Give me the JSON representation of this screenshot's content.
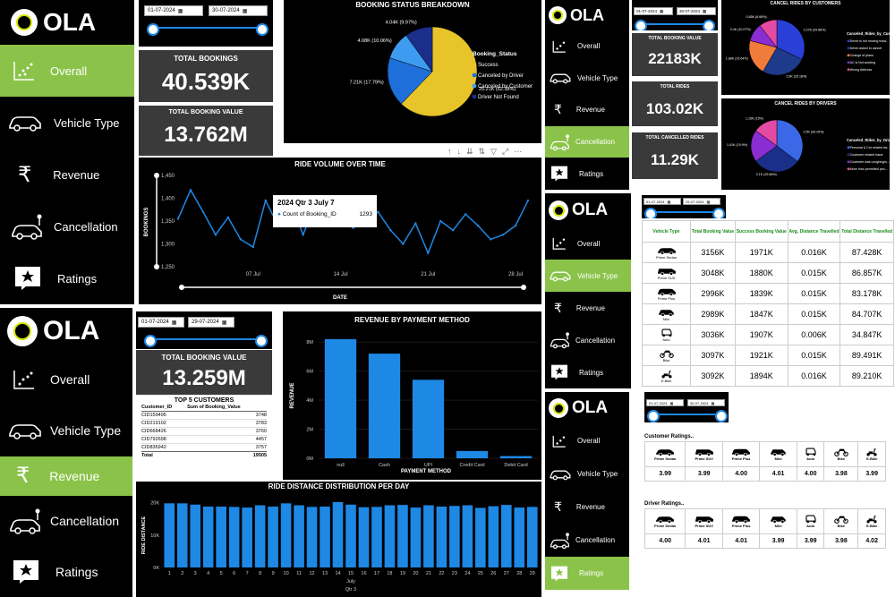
{
  "brand": "OLA",
  "nav": [
    "Overall",
    "Vehicle Type",
    "Revenue",
    "Cancellation",
    "Ratings"
  ],
  "panel_overall": {
    "date_from": "01-07-2024",
    "date_to": "30-07-2024",
    "total_bookings_label": "TOTAL BOOKINGS",
    "total_bookings": "40.539K",
    "total_value_label": "TOTAL BOOKING VALUE",
    "total_value": "13.762M",
    "pie_title": "BOOKING STATUS BREAKDOWN",
    "pie_legend_title": "Booking_Status",
    "line_title": "RIDE VOLUME OVER TIME",
    "line_ylabel": "BOOKINGS",
    "line_xlabel": "DATE",
    "tooltip_title": "2024 Qtr 3 July 7",
    "tooltip_label": "Count of Booking_ID",
    "tooltip_value": "1293"
  },
  "panel_revenue": {
    "date_from": "01-07-2024",
    "date_to": "29-07-2024",
    "total_value_label": "TOTAL BOOKING VALUE",
    "total_value": "13.259M",
    "top5_title": "TOP 5 CUSTOMERS",
    "top5_headers": [
      "Customer_ID",
      "Sum of Booking_Value"
    ],
    "top5_rows": [
      [
        "CID159495",
        "3748"
      ],
      [
        "CID219102",
        "3783"
      ],
      [
        "CID668426",
        "3760"
      ],
      [
        "CID792698",
        "4457"
      ],
      [
        "CID836942",
        "3757"
      ]
    ],
    "top5_total": [
      "Total",
      "19505"
    ],
    "bar_title": "REVENUE BY PAYMENT METHOD",
    "bar_ylabel": "REVENUE",
    "bar_xlabel": "PAYMENT METHOD",
    "dist_title": "RIDE DISTANCE DISTRIBUTION PER DAY",
    "dist_ylabel": "RIDE DISTANCE",
    "dist_xlabel": "July",
    "dist_xlabel2": "Qtr 3"
  },
  "panel_cancel": {
    "date_from": "01-07-2024",
    "date_to": "30-07-2024",
    "total_value_label": "TOTAL BOOKING VALUE",
    "total_value": "22183K",
    "total_rides_label": "TOTAL RIDES",
    "total_rides": "103.02K",
    "total_cancelled_label": "TOTAL CANCELLED RIDES",
    "total_cancelled": "11.29K",
    "cust_title": "CANCEL RIDES BY CUSTOMERS",
    "cust_legend_title": "Canceled_Rides_by_Custome",
    "cust_legend": [
      "Driver is not moving towa...",
      "Driver asked to cancel",
      "Change of plans",
      "AC is Not working",
      "Wrong Address"
    ],
    "drv_title": "CANCEL RIDES BY DRIVERS",
    "drv_legend_title": "Canceled_Rides_by_Driver",
    "drv_legend": [
      "Personal & Car related iss...",
      "Customer related issue",
      "Customer was coughing/s...",
      "More than permitted peo..."
    ]
  },
  "panel_vehicle": {
    "date_from": "01-07-2024",
    "date_to": "29-07-2024",
    "headers": [
      "Vehicle Type",
      "Total Booking Value",
      "Success Booking Value",
      "Avg. Distance Travelled",
      "Total Distance Travelled"
    ],
    "rows": [
      {
        "name": "Prime Sedan",
        "total": "3156K",
        "success": "1971K",
        "avg": "0.016K",
        "dist": "87.428K"
      },
      {
        "name": "Prime SUV",
        "total": "3048K",
        "success": "1880K",
        "avg": "0.015K",
        "dist": "86.857K"
      },
      {
        "name": "Prime Plus",
        "total": "2996K",
        "success": "1839K",
        "avg": "0.015K",
        "dist": "83.178K"
      },
      {
        "name": "Mini",
        "total": "2989K",
        "success": "1847K",
        "avg": "0.015K",
        "dist": "84.707K"
      },
      {
        "name": "Auto",
        "total": "3036K",
        "success": "1907K",
        "avg": "0.006K",
        "dist": "34.847K"
      },
      {
        "name": "Bike",
        "total": "3097K",
        "success": "1921K",
        "avg": "0.015K",
        "dist": "89.491K"
      },
      {
        "name": "E-Bike",
        "total": "3092K",
        "success": "1894K",
        "avg": "0.016K",
        "dist": "89.210K"
      }
    ]
  },
  "panel_ratings": {
    "date_from": "01-07-2024",
    "date_to": "30-07-2024",
    "customer_title": "Customer Ratings..",
    "driver_title": "Driver Ratings..",
    "vehicles": [
      "Prime Sedan",
      "Prime SUV",
      "Prime Plus",
      "Mini",
      "Auto",
      "Bike",
      "E-Bike"
    ],
    "customer": [
      "3.99",
      "3.99",
      "4.00",
      "4.01",
      "4.00",
      "3.98",
      "3.99"
    ],
    "driver": [
      "4.00",
      "4.01",
      "4.01",
      "3.99",
      "3.99",
      "3.98",
      "4.02"
    ]
  },
  "colors": {
    "accent": "#8bc34a",
    "blue": "#1e88e5",
    "panel": "#3a3a3a",
    "yellow": "#e6c42a"
  },
  "chart_data": [
    {
      "type": "pie",
      "title": "BOOKING STATUS BREAKDOWN",
      "legend_title": "Booking_Status",
      "slices": [
        {
          "name": "Success",
          "value": 25.21,
          "label": "25.21K (62.18%)",
          "color": "#e6c42a"
        },
        {
          "name": "Canceled by Driver",
          "value": 7.21,
          "label": "7.21K (17.79%)",
          "color": "#1e6fd9"
        },
        {
          "name": "Canceled by Customer",
          "value": 4.08,
          "label": "4.08K (10.06%)",
          "color": "#3d9cf0"
        },
        {
          "name": "Driver Not Found",
          "value": 4.04,
          "label": "4.04K (9.97%)",
          "color": "#1a2f8a"
        }
      ]
    },
    {
      "type": "line",
      "title": "RIDE VOLUME OVER TIME",
      "xlabel": "DATE",
      "ylabel": "BOOKINGS",
      "ylim": [
        1250,
        1450
      ],
      "yticks": [
        1250,
        1300,
        1350,
        1400,
        1450
      ],
      "xticks": [
        "07 Jul",
        "14 Jul",
        "21 Jul",
        "28 Jul"
      ],
      "series": [
        {
          "values": [
            1355,
            1418,
            1370,
            1320,
            1358,
            1310,
            1293,
            1395,
            1340,
            1390,
            1320,
            1390,
            1380,
            1360,
            1335,
            1350,
            1370,
            1330,
            1300,
            1345,
            1280,
            1350,
            1330,
            1365,
            1340,
            1310,
            1320,
            1340,
            1395
          ]
        }
      ]
    },
    {
      "type": "bar",
      "title": "REVENUE BY PAYMENT METHOD",
      "xlabel": "PAYMENT METHOD",
      "ylabel": "REVENUE",
      "categories": [
        "null",
        "Cash",
        "UPI",
        "Credit Card",
        "Debit Card"
      ],
      "values": [
        8.2,
        7.2,
        5.4,
        0.5,
        0.15
      ],
      "yticks": [
        "0M",
        "2M",
        "4M",
        "6M",
        "8M"
      ],
      "ylim": [
        0,
        8.5
      ]
    },
    {
      "type": "bar",
      "title": "RIDE DISTANCE DISTRIBUTION PER DAY",
      "ylabel": "RIDE DISTANCE",
      "xlabel": "July",
      "categories": [
        "1",
        "2",
        "3",
        "4",
        "5",
        "6",
        "7",
        "8",
        "9",
        "10",
        "11",
        "12",
        "13",
        "14",
        "15",
        "16",
        "17",
        "18",
        "19",
        "20",
        "21",
        "22",
        "23",
        "24",
        "25",
        "26",
        "27",
        "28",
        "29"
      ],
      "values": [
        19.8,
        19.8,
        19.4,
        18.8,
        18.8,
        18.7,
        18.5,
        19.2,
        18.8,
        19.8,
        19.2,
        18.7,
        18.8,
        20.2,
        19.4,
        18.6,
        18.7,
        19.2,
        19.3,
        18.5,
        19.2,
        18.8,
        19.0,
        19.2,
        18.4,
        18.9,
        19.3,
        18.5,
        18.7
      ],
      "yticks": [
        "0K",
        "10K",
        "20K"
      ],
      "ylim": [
        0,
        21
      ]
    },
    {
      "type": "pie",
      "title": "CANCEL RIDES BY CUSTOMERS",
      "slices": [
        {
          "name": "Driver is not moving towa...",
          "value": 30.5,
          "label": "3.27K (29.88%)",
          "color": "#2a3fd6"
        },
        {
          "name": "Driver asked to cancel",
          "value": 25,
          "label": "2.6K (25.18%)",
          "color": "#1e3a8a"
        },
        {
          "name": "Change of plans",
          "value": 19.6,
          "label": "1.88K (19.64%)",
          "color": "#f07b3b"
        },
        {
          "name": "AC is Not working",
          "value": 10,
          "label": "0.4K (10.07%)",
          "color": "#8a2dd1"
        },
        {
          "name": "Wrong Address",
          "value": 10,
          "label": "0.85K (8.68%)",
          "color": "#e44aa2"
        }
      ]
    },
    {
      "type": "pie",
      "title": "CANCEL RIDES BY DRIVERS",
      "slices": [
        {
          "name": "Personal & Car related iss...",
          "value": 35.25,
          "label": "2.5K (35.25%)",
          "color": "#3b68e6"
        },
        {
          "name": "Customer related issue",
          "value": 29.6,
          "label": "2.1K (29.68%)",
          "color": "#1a2f8a"
        },
        {
          "name": "Customer was coughing/s...",
          "value": 20,
          "label": "1.41K (19.9%)",
          "color": "#8a2dd1"
        },
        {
          "name": "More than permitted peo...",
          "value": 15,
          "label": "1.15K (15%)",
          "color": "#e44aa2"
        }
      ]
    }
  ]
}
